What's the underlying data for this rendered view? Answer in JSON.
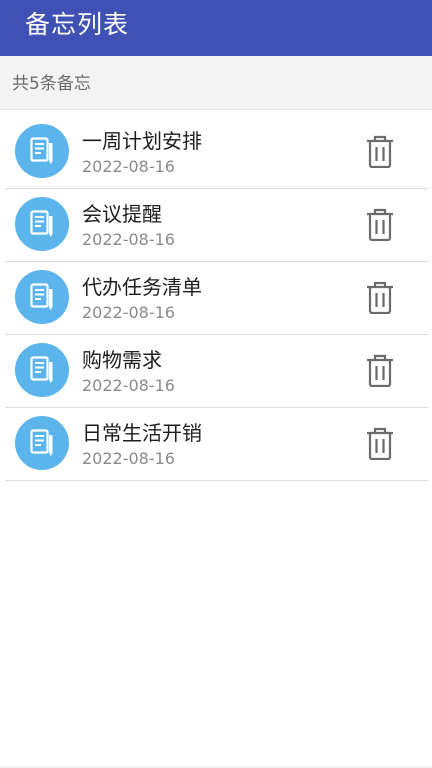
{
  "app_bar": {
    "title": "备忘列表"
  },
  "summary": {
    "count_text": "共5条备忘"
  },
  "colors": {
    "app_bar": "#3f51b5",
    "avatar": "#5bb4ec",
    "delete_icon": "#6b6b6b"
  },
  "memos": [
    {
      "title": "一周计划安排",
      "date": "2022-08-16",
      "icon": "note-icon",
      "action_icon": "trash-icon"
    },
    {
      "title": "会议提醒",
      "date": "2022-08-16",
      "icon": "note-icon",
      "action_icon": "trash-icon"
    },
    {
      "title": "代办任务清单",
      "date": "2022-08-16",
      "icon": "note-icon",
      "action_icon": "trash-icon"
    },
    {
      "title": "购物需求",
      "date": "2022-08-16",
      "icon": "note-icon",
      "action_icon": "trash-icon"
    },
    {
      "title": "日常生活开销",
      "date": "2022-08-16",
      "icon": "note-icon",
      "action_icon": "trash-icon"
    }
  ]
}
